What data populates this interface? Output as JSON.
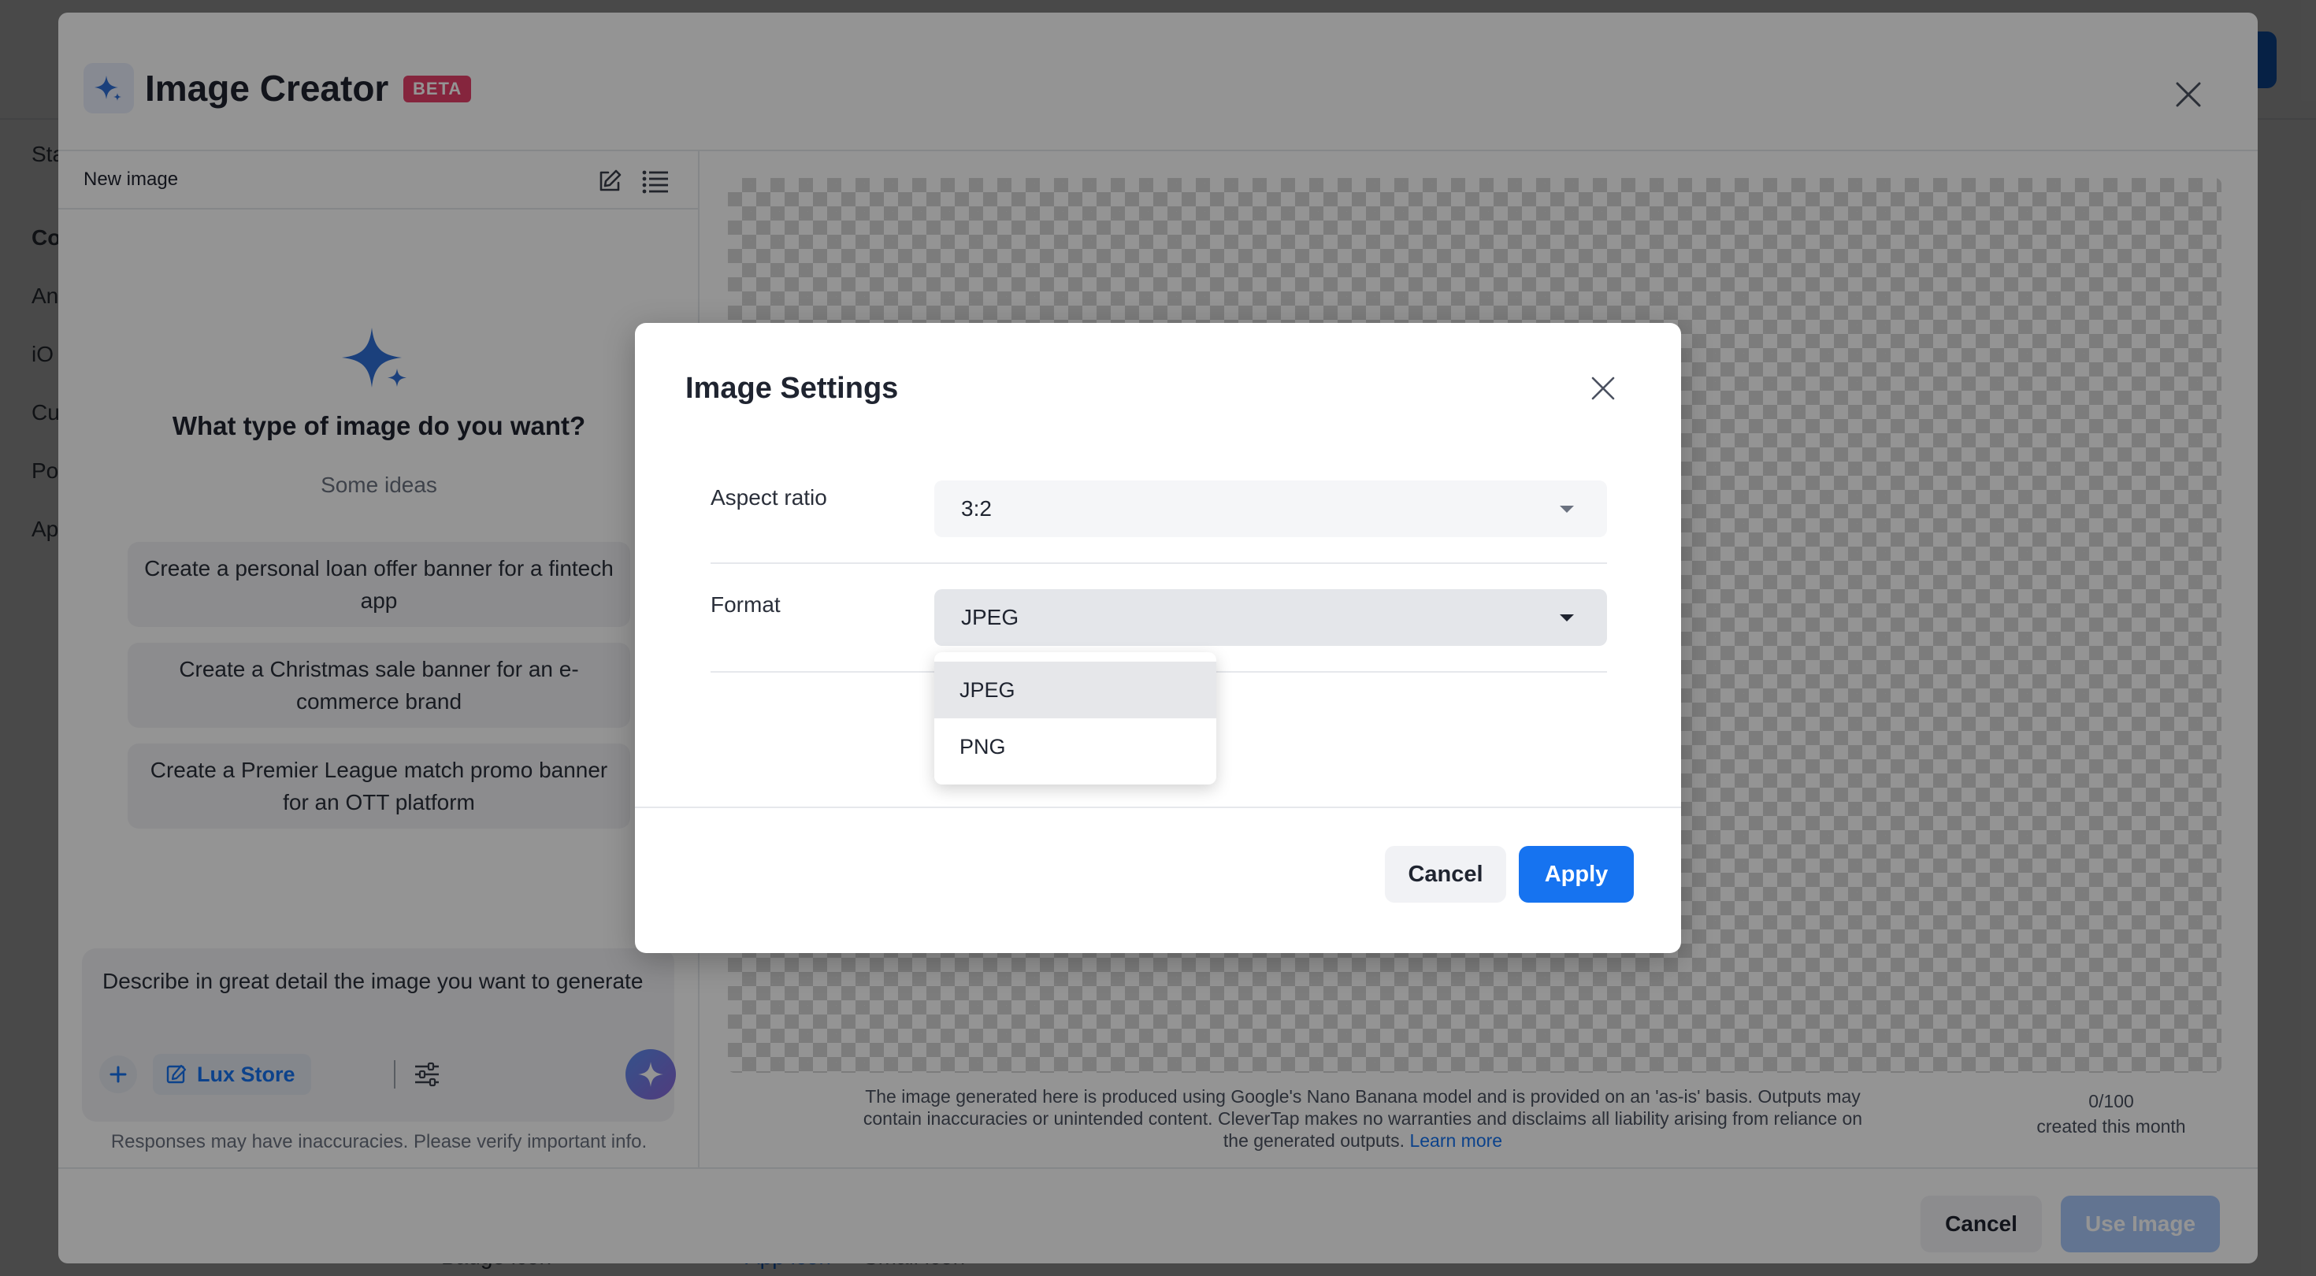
{
  "background": {
    "side_items": [
      "Sta",
      "Co",
      "An",
      "iO",
      "Cu",
      "Po",
      "Ap"
    ],
    "bottom_items": [
      "Badge icon",
      "App icon",
      "Small icon"
    ]
  },
  "creator": {
    "title": "Image Creator",
    "badge": "BETA",
    "left": {
      "subheader": "New image",
      "question": "What type of image do you want?",
      "ideas_label": "Some ideas",
      "ideas": [
        "Create a personal loan offer banner for a fintech app",
        "Create a Christmas sale banner for an e-commerce brand",
        "Create a Premier League match promo banner for an OTT platform"
      ],
      "prompt_placeholder": "Describe in great detail the image you want to generate",
      "brand_chip": "Lux Store",
      "disclaimer": "Responses may have inaccuracies. Please verify important info."
    },
    "right": {
      "legal_text": "The image generated here is produced using Google's Nano Banana model and is provided on an 'as-is' basis. Outputs may contain inaccuracies or unintended content. CleverTap makes no warranties and disclaims all liability arising from reliance on the generated outputs.",
      "learn_more": "Learn more",
      "count": "0/100",
      "count_caption": "created this month"
    },
    "footer": {
      "cancel": "Cancel",
      "use_image": "Use Image"
    }
  },
  "settings_dialog": {
    "title": "Image Settings",
    "aspect_label": "Aspect ratio",
    "aspect_value": "3:2",
    "format_label": "Format",
    "format_value": "JPEG",
    "format_options": [
      "JPEG",
      "PNG"
    ],
    "cancel": "Cancel",
    "apply": "Apply"
  },
  "colors": {
    "primary": "#1673f0",
    "beta_badge": "#e6406a",
    "sparkle": "#2f6fd6"
  }
}
